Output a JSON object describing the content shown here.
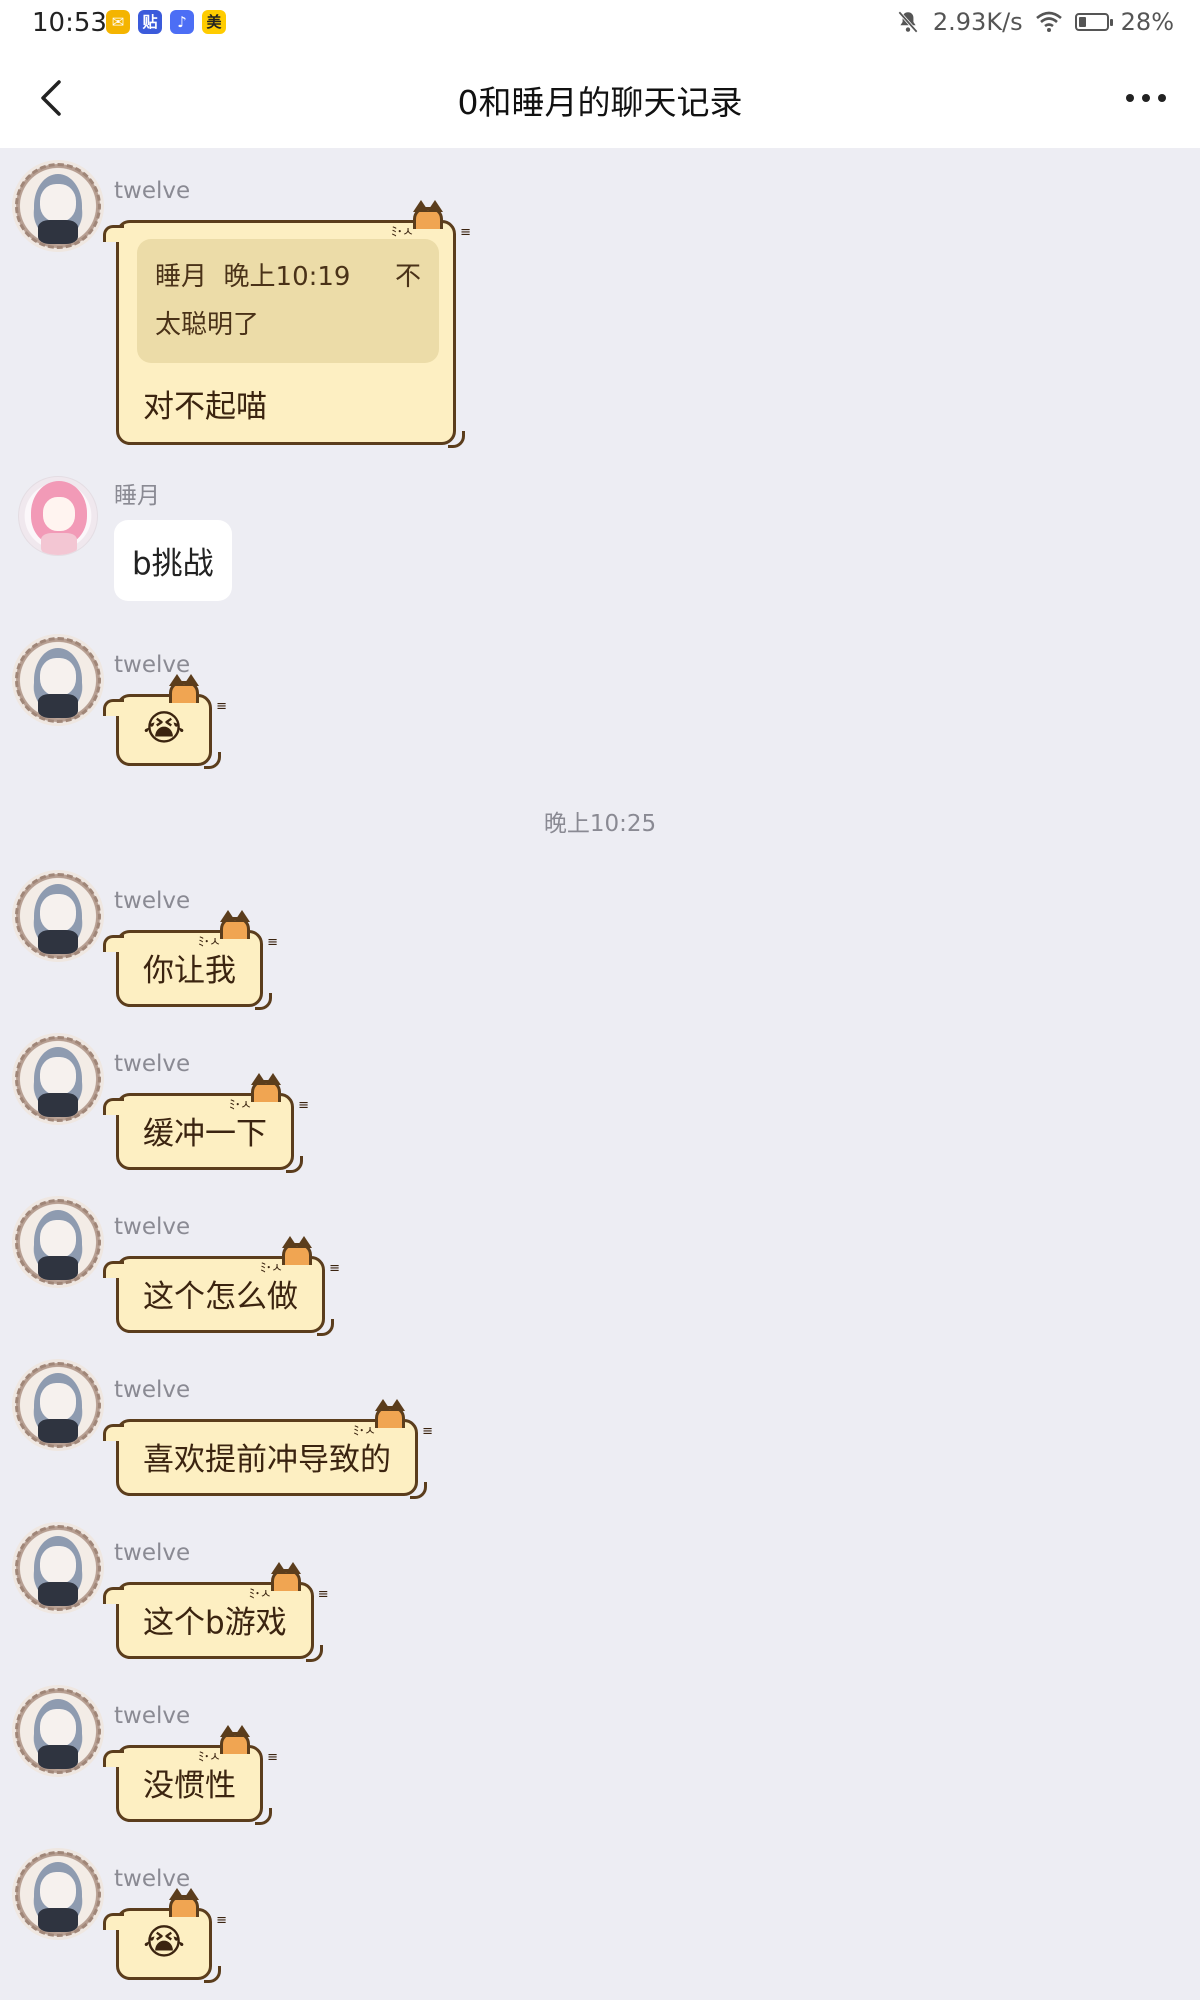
{
  "status_bar": {
    "time": "10:53",
    "apps": [
      {
        "name": "mail-app-icon",
        "glyph": "✉",
        "color": "#f4b400"
      },
      {
        "name": "tieba-app-icon",
        "glyph": "贴",
        "color": "#3b5bdb"
      },
      {
        "name": "music-app-icon",
        "glyph": "♪",
        "color": "#4c6ef5"
      },
      {
        "name": "meituan-app-icon",
        "glyph": "美",
        "color": "#ffcc00"
      }
    ],
    "net_speed": "2.93K/s",
    "battery": "28%",
    "battery_level": 0.28
  },
  "nav": {
    "title": "0和睡月的聊天记录"
  },
  "messages": [
    {
      "sender": "twelve",
      "quote": {
        "author": "睡月",
        "time": "晚上10:19",
        "text_a": "不",
        "text_b": "太聪明了"
      },
      "text": "对不起喵"
    },
    {
      "sender": "睡月",
      "text": "b挑战"
    },
    {
      "sender": "twelve",
      "text": "😭"
    },
    {
      "time_divider": "晚上10:25"
    },
    {
      "sender": "twelve",
      "text": "你让我"
    },
    {
      "sender": "twelve",
      "text": "缓冲一下"
    },
    {
      "sender": "twelve",
      "text": "这个怎么做"
    },
    {
      "sender": "twelve",
      "text": "喜欢提前冲导致的"
    },
    {
      "sender": "twelve",
      "text": "这个b游戏"
    },
    {
      "sender": "twelve",
      "text": "没惯性"
    },
    {
      "sender": "twelve",
      "text": "😭"
    }
  ],
  "colors": {
    "background": "#ededf3",
    "cat_bubble_fill": "#fdefc2",
    "cat_bubble_border": "#5b3d1c",
    "quote_fill": "#ecdca8"
  }
}
